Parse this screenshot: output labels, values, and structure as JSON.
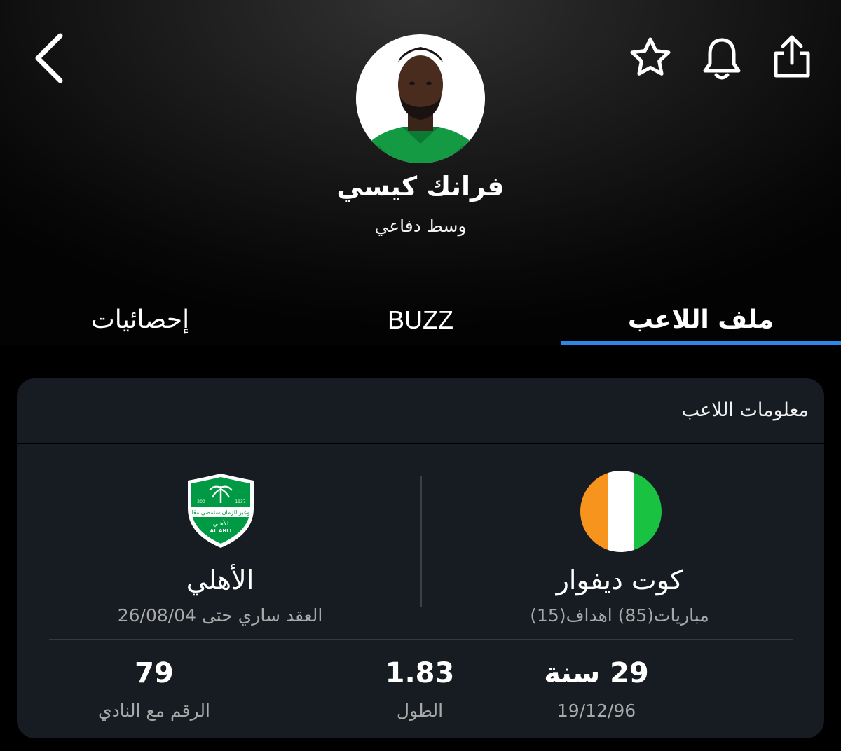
{
  "player": {
    "name": "فرانك كيسي",
    "position": "وسط دفاعي"
  },
  "actions": {
    "back_icon": "chevron-left-icon",
    "favorite_icon": "star-icon",
    "notify_icon": "bell-icon",
    "share_icon": "share-icon"
  },
  "tabs": [
    {
      "label": "إحصائيات",
      "selected": false
    },
    {
      "label": "BUZZ",
      "selected": false
    },
    {
      "label": "ملف اللاعب",
      "selected": true
    }
  ],
  "colors": {
    "accent": "#2f86e6",
    "card_bg": "#161c22",
    "flag_orange": "#f7941d",
    "flag_white": "#ffffff",
    "flag_green": "#19c241",
    "club_green": "#009a44"
  },
  "info_card": {
    "title": "معلومات اللاعب",
    "country": {
      "name": "كوت ديفوار",
      "stats": "مباريات(85) اهداف(15)"
    },
    "club": {
      "name": "الأهلي",
      "contract": "العقد ساري حتى 26/08/04",
      "badge_top_left": "200",
      "badge_top_right": "1937",
      "badge_motto": "وعبر الزمان ستمضي معًا",
      "badge_name_ar": "الأهلي",
      "badge_name_en": "AL AHLI"
    },
    "stats": {
      "age_value": "29 سنة",
      "age_label": "19/12/96",
      "height_value": "1.83",
      "height_label": "الطول",
      "number_value": "79",
      "number_label": "الرقم مع النادي"
    }
  }
}
